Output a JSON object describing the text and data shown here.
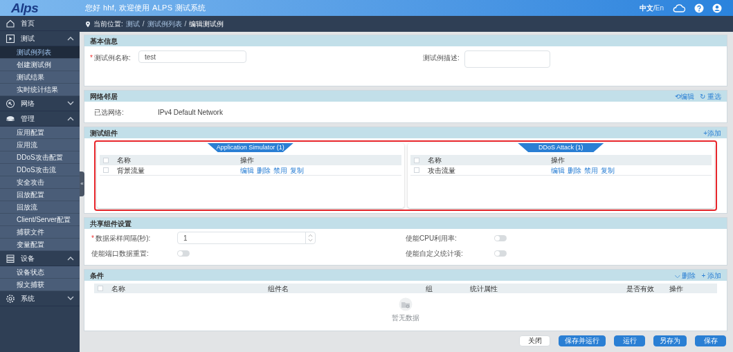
{
  "header": {
    "logo": "Alps",
    "greeting": "您好 hhf, 欢迎使用 ALPS 测试系统",
    "languages": [
      {
        "label": "中文",
        "selected": true
      },
      {
        "label": "En",
        "selected": false
      }
    ],
    "language_separator": "/"
  },
  "sidebar": {
    "items": [
      {
        "label": "首页"
      },
      {
        "label": "测试",
        "expanded": true,
        "children": [
          {
            "label": "测试例列表",
            "selected": true
          },
          {
            "label": "创建测试例",
            "selected": false
          },
          {
            "label": "测试结果",
            "selected": false
          },
          {
            "label": "实时统计结果",
            "selected": false
          }
        ]
      },
      {
        "label": "网络",
        "expanded": false
      },
      {
        "label": "管理",
        "expanded": true,
        "children": [
          {
            "label": "应用配置",
            "selected": false
          },
          {
            "label": "应用流",
            "selected": false
          },
          {
            "label": "DDoS攻击配置",
            "selected": false
          },
          {
            "label": "DDoS攻击流",
            "selected": false
          },
          {
            "label": "安全攻击",
            "selected": false
          },
          {
            "label": "回放配置",
            "selected": false
          },
          {
            "label": "回放流",
            "selected": false
          },
          {
            "label": "Client/Server配置",
            "selected": false
          },
          {
            "label": "捕获文件",
            "selected": false
          },
          {
            "label": "变量配置",
            "selected": false
          }
        ]
      },
      {
        "label": "设备",
        "expanded": true,
        "children": [
          {
            "label": "设备状态",
            "selected": false
          },
          {
            "label": "报文捕获",
            "selected": false
          }
        ]
      },
      {
        "label": "系统",
        "expanded": false
      }
    ]
  },
  "collapse_handle": "«",
  "breadcrumb": {
    "label": "当前位置:",
    "path": [
      "测试",
      "测试例列表",
      "编辑测试例"
    ],
    "separator": "/"
  },
  "basic_info": {
    "title": "基本信息",
    "name_label": "测试例名称:",
    "name_required_mark": "*",
    "name_value": "test",
    "desc_label": "测试例描述:"
  },
  "network": {
    "title": "网络邻居",
    "actions": [
      "⟲编辑",
      "↻ 重选"
    ],
    "label": "已选网络:",
    "value": "IPv4 Default Network"
  },
  "components": {
    "title": "测试组件",
    "action": "+添加",
    "highlighted": true,
    "panels": [
      {
        "tab": "Application Simulator (1)",
        "columns": [
          "名称",
          "操作"
        ],
        "all_checked": false,
        "rows": [
          {
            "name": "背景流量",
            "checked": false,
            "actions": [
              "编辑",
              "删除",
              "禁用",
              "复制"
            ]
          }
        ]
      },
      {
        "tab": "DDoS Attack (1)",
        "columns": [
          "名称",
          "操作"
        ],
        "all_checked": false,
        "rows": [
          {
            "name": "攻击流量",
            "checked": false,
            "actions": [
              "编辑",
              "删除",
              "禁用",
              "复制"
            ]
          }
        ]
      }
    ]
  },
  "shared": {
    "title": "共享组件设置",
    "fields": [
      {
        "kind": "number",
        "label": "数据采样间隔(秒):",
        "required_mark": "*",
        "value": "1"
      },
      {
        "kind": "toggle",
        "label": "使能CPU利用率:",
        "on": false
      },
      {
        "kind": "toggle",
        "label": "使能端口数据重置:",
        "on": false
      },
      {
        "kind": "toggle",
        "label": "使能自定义统计项:",
        "on": false
      }
    ]
  },
  "conditions": {
    "title": "条件",
    "actions": [
      "⌵ 删除",
      "+ 添加"
    ],
    "columns": [
      "名称",
      "组件名",
      "组",
      "统计属性",
      "是否有效",
      "操作"
    ],
    "all_checked": false,
    "empty_text": "暂无数据"
  },
  "buttons": [
    {
      "label": "关闭",
      "kind": "default"
    },
    {
      "label": "保存并运行",
      "kind": "primary"
    },
    {
      "label": "运行",
      "kind": "primary"
    },
    {
      "label": "另存为",
      "kind": "primary"
    },
    {
      "label": "保存",
      "kind": "primary"
    }
  ]
}
